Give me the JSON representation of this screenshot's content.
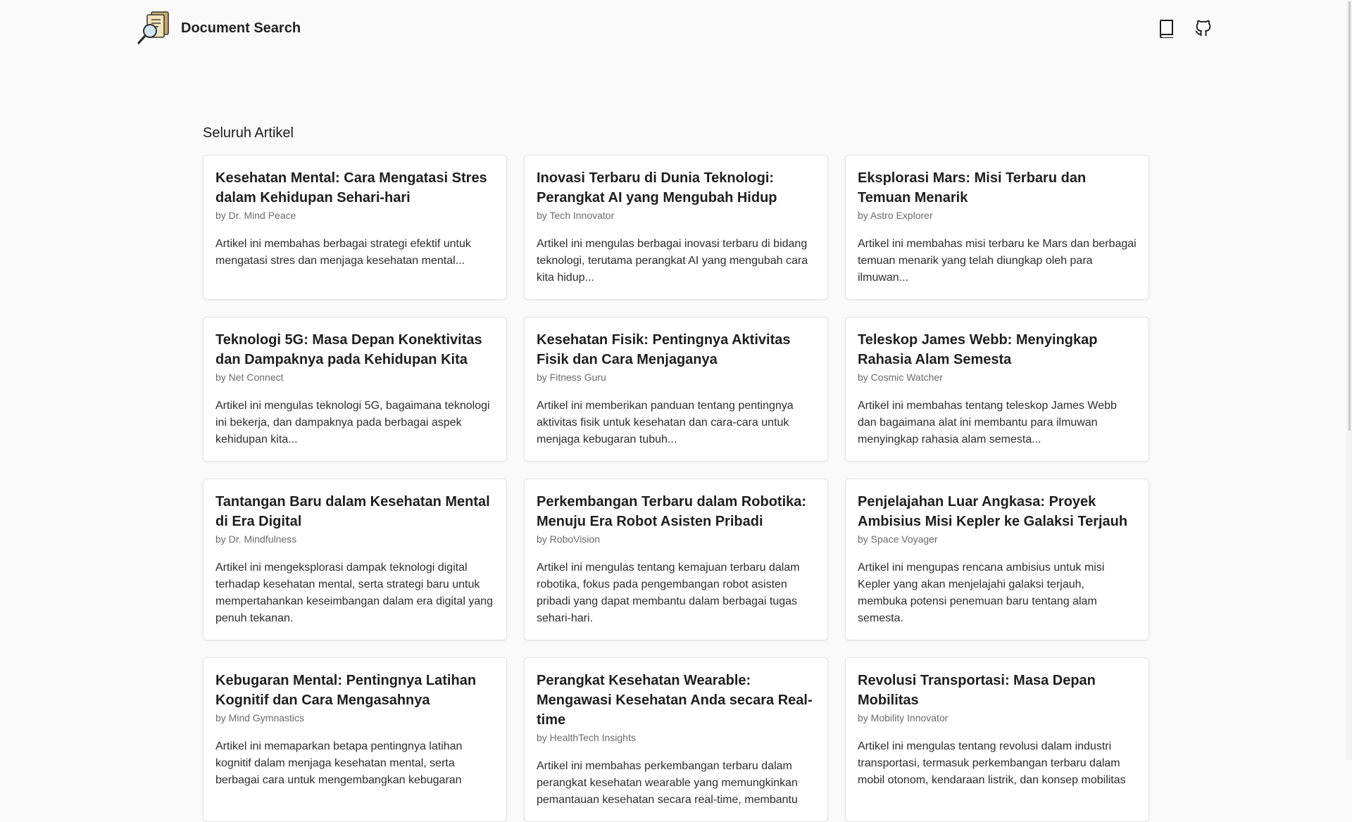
{
  "header": {
    "title": "Document Search",
    "actions": [
      {
        "icon": "book-icon"
      },
      {
        "icon": "github-icon"
      }
    ]
  },
  "main": {
    "section_title": "Seluruh Artikel",
    "articles": [
      {
        "title": "Kesehatan Mental: Cara Mengatasi Stres dalam Kehidupan Sehari-hari",
        "author": "by Dr. Mind Peace",
        "excerpt": "Artikel ini membahas berbagai strategi efektif untuk mengatasi stres dan menjaga kesehatan mental..."
      },
      {
        "title": "Inovasi Terbaru di Dunia Teknologi: Perangkat AI yang Mengubah Hidup",
        "author": "by Tech Innovator",
        "excerpt": "Artikel ini mengulas berbagai inovasi terbaru di bidang teknologi, terutama perangkat AI yang mengubah cara kita hidup..."
      },
      {
        "title": "Eksplorasi Mars: Misi Terbaru dan Temuan Menarik",
        "author": "by Astro Explorer",
        "excerpt": "Artikel ini membahas misi terbaru ke Mars dan berbagai temuan menarik yang telah diungkap oleh para ilmuwan..."
      },
      {
        "title": "Teknologi 5G: Masa Depan Konektivitas dan Dampaknya pada Kehidupan Kita",
        "author": "by Net Connect",
        "excerpt": "Artikel ini mengulas teknologi 5G, bagaimana teknologi ini bekerja, dan dampaknya pada berbagai aspek kehidupan kita..."
      },
      {
        "title": "Kesehatan Fisik: Pentingnya Aktivitas Fisik dan Cara Menjaganya",
        "author": "by Fitness Guru",
        "excerpt": "Artikel ini memberikan panduan tentang pentingnya aktivitas fisik untuk kesehatan dan cara-cara untuk menjaga kebugaran tubuh..."
      },
      {
        "title": "Teleskop James Webb: Menyingkap Rahasia Alam Semesta",
        "author": "by Cosmic Watcher",
        "excerpt": "Artikel ini membahas tentang teleskop James Webb dan bagaimana alat ini membantu para ilmuwan menyingkap rahasia alam semesta..."
      },
      {
        "title": "Tantangan Baru dalam Kesehatan Mental di Era Digital",
        "author": "by Dr. Mindfulness",
        "excerpt": "Artikel ini mengeksplorasi dampak teknologi digital terhadap kesehatan mental, serta strategi baru untuk mempertahankan keseimbangan dalam era digital yang penuh tekanan."
      },
      {
        "title": "Perkembangan Terbaru dalam Robotika: Menuju Era Robot Asisten Pribadi",
        "author": "by RoboVision",
        "excerpt": "Artikel ini mengulas tentang kemajuan terbaru dalam robotika, fokus pada pengembangan robot asisten pribadi yang dapat membantu dalam berbagai tugas sehari-hari."
      },
      {
        "title": "Penjelajahan Luar Angkasa: Proyek Ambisius Misi Kepler ke Galaksi Terjauh",
        "author": "by Space Voyager",
        "excerpt": "Artikel ini mengupas rencana ambisius untuk misi Kepler yang akan menjelajahi galaksi terjauh, membuka potensi penemuan baru tentang alam semesta."
      },
      {
        "title": "Kebugaran Mental: Pentingnya Latihan Kognitif dan Cara Mengasahnya",
        "author": "by Mind Gymnastics",
        "excerpt": "Artikel ini memaparkan betapa pentingnya latihan kognitif dalam menjaga kesehatan mental, serta berbagai cara untuk mengembangkan kebugaran"
      },
      {
        "title": "Perangkat Kesehatan Wearable: Mengawasi Kesehatan Anda secara Real-time",
        "author": "by HealthTech Insights",
        "excerpt": "Artikel ini membahas perkembangan terbaru dalam perangkat kesehatan wearable yang memungkinkan pemantauan kesehatan secara real-time, membantu"
      },
      {
        "title": "Revolusi Transportasi: Masa Depan Mobilitas",
        "author": "by Mobility Innovator",
        "excerpt": "Artikel ini mengulas tentang revolusi dalam industri transportasi, termasuk perkembangan terbaru dalam mobil otonom, kendaraan listrik, dan konsep mobilitas"
      }
    ]
  }
}
